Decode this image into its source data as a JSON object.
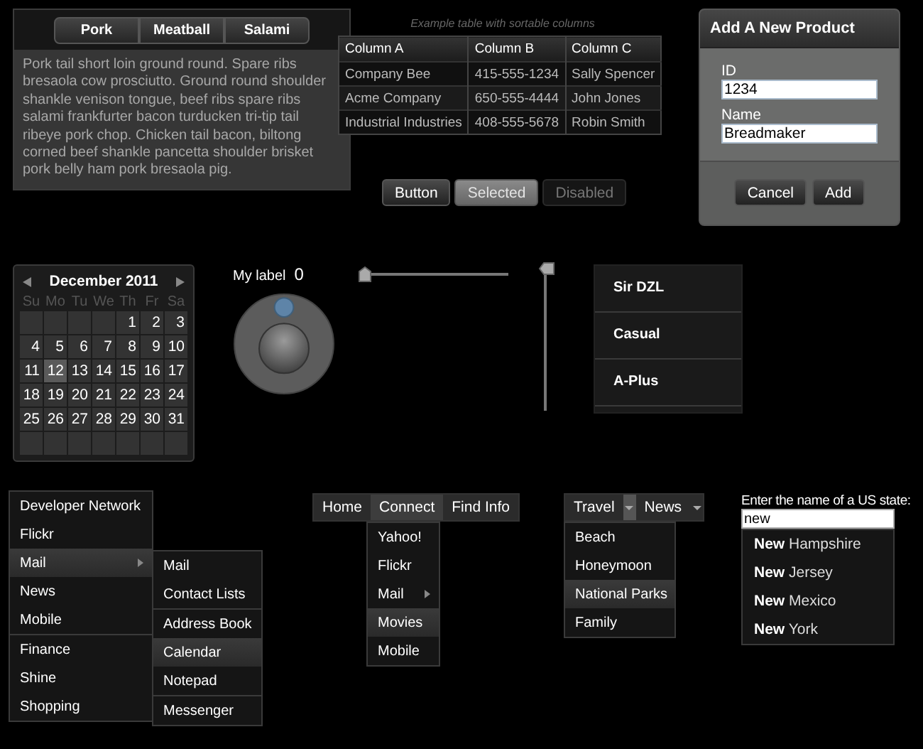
{
  "tab_panel": {
    "tabs": [
      {
        "label": "Pork",
        "selected": false
      },
      {
        "label": "Meatball",
        "selected": false
      },
      {
        "label": "Salami",
        "selected": false
      }
    ],
    "text": "Pork tail short loin ground round. Spare ribs bresaola cow prosciutto. Ground round shoulder shankle venison tongue, beef ribs spare ribs salami frankfurter bacon turducken tri-tip tail ribeye pork chop. Chicken tail bacon, biltong corned beef shankle pancetta shoulder brisket pork belly ham pork bresaola pig."
  },
  "table": {
    "caption": "Example table with sortable columns",
    "columns": [
      "Column A",
      "Column B",
      "Column C"
    ],
    "rows": [
      [
        "Company Bee",
        "415-555-1234",
        "Sally Spencer"
      ],
      [
        "Acme Company",
        "650-555-4444",
        "John Jones"
      ],
      [
        "Industrial Industries",
        "408-555-5678",
        "Robin Smith"
      ]
    ]
  },
  "buttons": [
    {
      "label": "Button",
      "selected": false,
      "disabled": false
    },
    {
      "label": "Selected",
      "selected": true,
      "disabled": false
    },
    {
      "label": "Disabled",
      "selected": false,
      "disabled": true
    }
  ],
  "dialog": {
    "title": "Add A New Product",
    "fields": [
      {
        "label": "ID",
        "value": "1234"
      },
      {
        "label": "Name",
        "value": "Breadmaker"
      }
    ],
    "buttons": [
      "Cancel",
      "Add"
    ]
  },
  "calendar": {
    "title": "December 2011",
    "weekdays": [
      "Su",
      "Mo",
      "Tu",
      "We",
      "Th",
      "Fr",
      "Sa"
    ],
    "weeks": [
      [
        {
          "label": "1",
          "selected": false
        },
        {
          "label": "2",
          "selected": false
        },
        {
          "label": "3",
          "selected": false
        }
      ],
      [
        {
          "label": "4",
          "selected": false
        },
        {
          "label": "5",
          "selected": false
        },
        {
          "label": "6",
          "selected": false
        },
        {
          "label": "7",
          "selected": false
        },
        {
          "label": "8",
          "selected": false
        },
        {
          "label": "9",
          "selected": false
        },
        {
          "label": "10",
          "selected": false
        }
      ],
      [
        {
          "label": "11",
          "selected": false
        },
        {
          "label": "12",
          "selected": true
        },
        {
          "label": "13",
          "selected": false
        },
        {
          "label": "14",
          "selected": false
        },
        {
          "label": "15",
          "selected": false
        },
        {
          "label": "16",
          "selected": false
        },
        {
          "label": "17",
          "selected": false
        }
      ],
      [
        {
          "label": "18",
          "selected": false
        },
        {
          "label": "19",
          "selected": false
        },
        {
          "label": "20",
          "selected": false
        },
        {
          "label": "21",
          "selected": false
        },
        {
          "label": "22",
          "selected": false
        },
        {
          "label": "23",
          "selected": false
        },
        {
          "label": "24",
          "selected": false
        }
      ],
      [
        {
          "label": "25",
          "selected": false
        },
        {
          "label": "26",
          "selected": false
        },
        {
          "label": "27",
          "selected": false
        },
        {
          "label": "28",
          "selected": false
        },
        {
          "label": "29",
          "selected": false
        },
        {
          "label": "30",
          "selected": false
        },
        {
          "label": "31",
          "selected": false
        }
      ]
    ]
  },
  "knob": {
    "label": "My label",
    "reading": "0"
  },
  "sliders": [
    {
      "kind": "horizontal",
      "level": 0
    },
    {
      "kind": "vertical",
      "level": 1
    }
  ],
  "list": [
    "Sir DZL",
    "Casual",
    "A-Plus"
  ],
  "menu": {
    "groups": [
      [
        {
          "label": "Developer Network",
          "selected": false
        },
        {
          "label": "Flickr",
          "selected": false
        },
        {
          "label": "Mail",
          "selected": true,
          "submenu": {
            "groups": [
              [
                {
                  "label": "Mail",
                  "selected": false
                },
                {
                  "label": "Contact Lists",
                  "selected": false
                }
              ],
              [
                {
                  "label": "Address Book",
                  "selected": false
                },
                {
                  "label": "Calendar",
                  "selected": true
                },
                {
                  "label": "Notepad",
                  "selected": false
                }
              ],
              [
                {
                  "label": "Messenger",
                  "selected": false
                }
              ]
            ]
          }
        },
        {
          "label": "News",
          "selected": false
        },
        {
          "label": "Mobile",
          "selected": false
        }
      ],
      [
        {
          "label": "Finance",
          "selected": false
        },
        {
          "label": "Shine",
          "selected": false
        },
        {
          "label": "Shopping",
          "selected": false
        }
      ]
    ]
  },
  "menubar": {
    "items": [
      {
        "label": "Home",
        "selected": false
      },
      {
        "label": "Connect",
        "selected": true,
        "menu": [
          {
            "label": "Yahoo!",
            "selected": false
          },
          {
            "label": "Flickr",
            "selected": false
          },
          {
            "label": "Mail",
            "selected": false,
            "has_submenu": true
          },
          {
            "label": "Movies",
            "selected": true
          },
          {
            "label": "Mobile",
            "selected": false
          }
        ]
      },
      {
        "label": "Find Info",
        "selected": false
      }
    ]
  },
  "dropdown_bar": {
    "items": [
      {
        "label": "Travel",
        "selected": true,
        "menu": [
          {
            "label": "Beach",
            "selected": false
          },
          {
            "label": "Honeymoon",
            "selected": false
          },
          {
            "label": "National Parks",
            "selected": true
          },
          {
            "label": "Family",
            "selected": false
          }
        ]
      },
      {
        "label": "News",
        "selected": false
      }
    ]
  },
  "autocomplete": {
    "label": "Enter the name of a US state:",
    "value": "new",
    "suggestions": [
      "**New** Hampshire",
      "**New** Jersey",
      "**New** Mexico",
      "**New** York"
    ]
  }
}
